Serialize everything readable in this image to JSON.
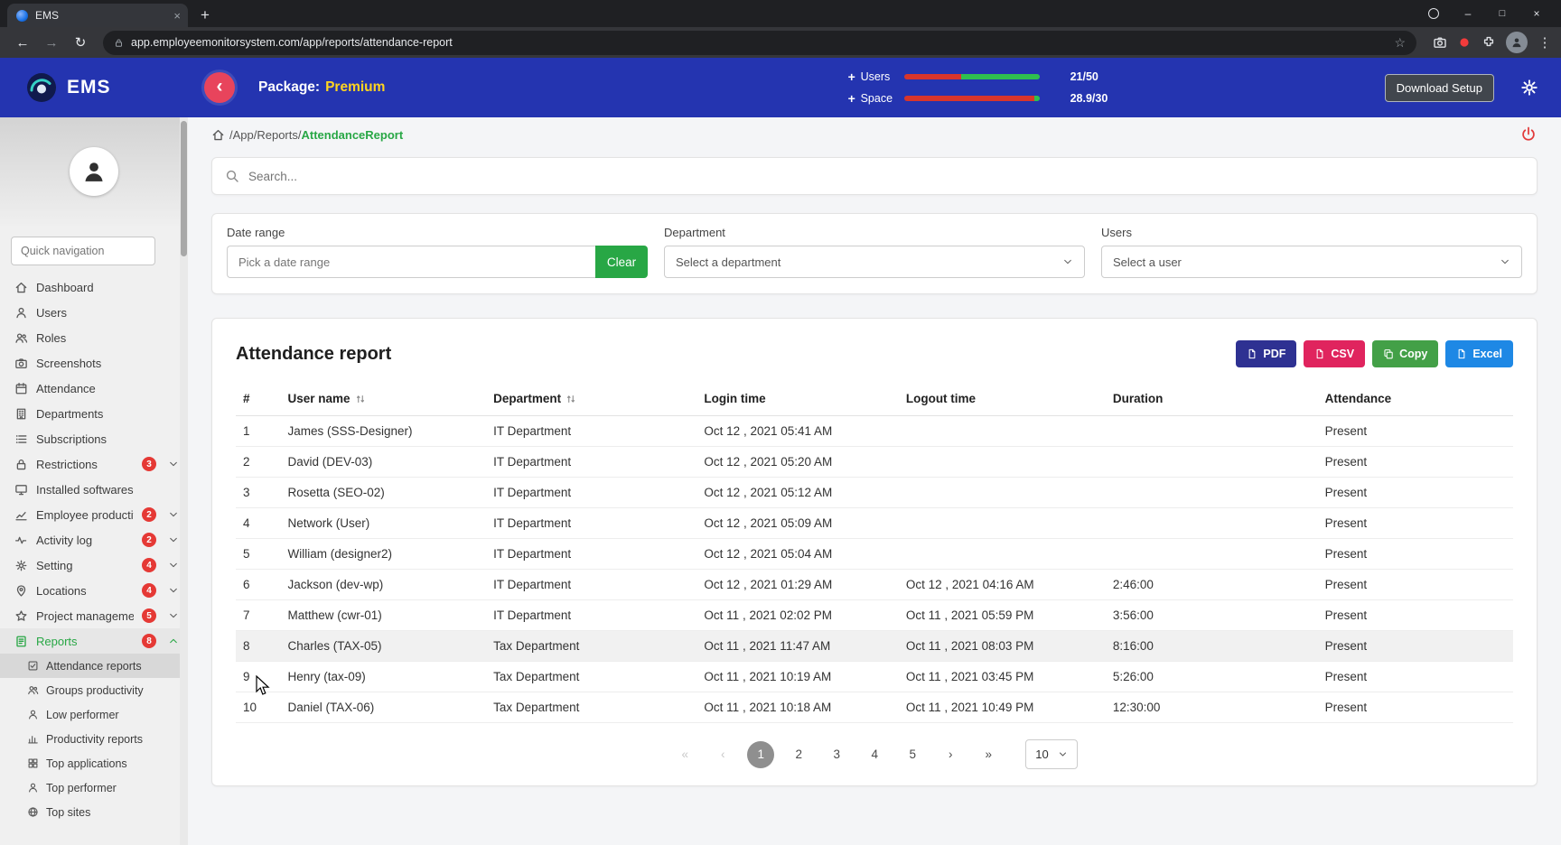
{
  "browser": {
    "tab_title": "EMS",
    "url": "app.employeemonitorsystem.com/app/reports/attendance-report",
    "glyphs": {
      "tab_close": "×",
      "new_tab": "+",
      "minimize": "–",
      "maximize": "□",
      "close": "×",
      "back": "←",
      "forward": "→",
      "reload": "↻",
      "star": "☆",
      "kebab": "⋮"
    }
  },
  "header": {
    "back_glyph": "‹",
    "package_label": "Package:",
    "package_value": "Premium",
    "add_glyph": "+",
    "users": {
      "label": "Users",
      "value": "21/50",
      "pct_used": 42
    },
    "space": {
      "label": "Space",
      "value": "28.9/30",
      "pct_used": 96
    },
    "bar_used_color": "#d8352b",
    "bar_free_color": "#2fbf4f",
    "download_button": "Download Setup"
  },
  "sidebar": {
    "quick_nav_placeholder": "Quick navigation",
    "items": [
      {
        "label": "Dashboard",
        "icon": "home-icon"
      },
      {
        "label": "Users",
        "icon": "user-icon"
      },
      {
        "label": "Roles",
        "icon": "users-icon"
      },
      {
        "label": "Screenshots",
        "icon": "camera-icon"
      },
      {
        "label": "Attendance",
        "icon": "calendar-icon"
      },
      {
        "label": "Departments",
        "icon": "building-icon"
      },
      {
        "label": "Subscriptions",
        "icon": "list-icon"
      },
      {
        "label": "Restrictions",
        "icon": "lock-icon",
        "badge": "3",
        "chevron": true
      },
      {
        "label": "Installed softwares",
        "icon": "monitor-icon"
      },
      {
        "label": "Employee productivity",
        "icon": "chart-line-icon",
        "badge": "2",
        "chevron": true
      },
      {
        "label": "Activity log",
        "icon": "activity-icon",
        "badge": "2",
        "chevron": true
      },
      {
        "label": "Setting",
        "icon": "gear-icon",
        "badge": "4",
        "chevron": true
      },
      {
        "label": "Locations",
        "icon": "pin-icon",
        "badge": "4",
        "chevron": true
      },
      {
        "label": "Project management",
        "icon": "star-icon",
        "badge": "5",
        "chevron": true
      },
      {
        "label": "Reports",
        "icon": "report-icon",
        "badge": "8",
        "chevron": true,
        "expanded": true,
        "active": true,
        "submenu": [
          {
            "label": "Attendance reports",
            "icon": "check-square-icon",
            "active": true
          },
          {
            "label": "Groups productivity",
            "icon": "users-icon"
          },
          {
            "label": "Low performer",
            "icon": "user-icon"
          },
          {
            "label": "Productivity reports",
            "icon": "bar-chart-icon"
          },
          {
            "label": "Top applications",
            "icon": "grid-icon"
          },
          {
            "label": "Top performer",
            "icon": "user-icon"
          },
          {
            "label": "Top sites",
            "icon": "globe-icon"
          }
        ]
      }
    ]
  },
  "breadcrumb": {
    "path": "/App/Reports/",
    "current": "AttendanceReport"
  },
  "search": {
    "placeholder": "Search..."
  },
  "filters": {
    "date_range_label": "Date range",
    "date_range_placeholder": "Pick a date range",
    "clear_button": "Clear",
    "department_label": "Department",
    "department_value": "Select a department",
    "users_label": "Users",
    "users_value": "Select a user"
  },
  "report": {
    "title": "Attendance report",
    "export_buttons": [
      {
        "label": "PDF",
        "color": "#2e3192",
        "icon": "file-icon"
      },
      {
        "label": "CSV",
        "color": "#e0245e",
        "icon": "file-icon"
      },
      {
        "label": "Copy",
        "color": "#43a047",
        "icon": "copy-icon"
      },
      {
        "label": "Excel",
        "color": "#1e88e5",
        "icon": "file-icon"
      }
    ],
    "table": {
      "columns": [
        {
          "label": "#",
          "sortable": false
        },
        {
          "label": "User name",
          "sortable": true
        },
        {
          "label": "Department",
          "sortable": true
        },
        {
          "label": "Login time",
          "sortable": false
        },
        {
          "label": "Logout time",
          "sortable": false
        },
        {
          "label": "Duration",
          "sortable": false
        },
        {
          "label": "Attendance",
          "sortable": false
        }
      ],
      "hover_row_index": 7,
      "rows": [
        [
          "1",
          "James (SSS-Designer)",
          "IT Department",
          "Oct 12 , 2021 05:41 AM",
          "",
          "",
          "Present"
        ],
        [
          "2",
          "David (DEV-03)",
          "IT Department",
          "Oct 12 , 2021 05:20 AM",
          "",
          "",
          "Present"
        ],
        [
          "3",
          "Rosetta (SEO-02)",
          "IT Department",
          "Oct 12 , 2021 05:12 AM",
          "",
          "",
          "Present"
        ],
        [
          "4",
          "Network (User)",
          "IT Department",
          "Oct 12 , 2021 05:09 AM",
          "",
          "",
          "Present"
        ],
        [
          "5",
          "William (designer2)",
          "IT Department",
          "Oct 12 , 2021 05:04 AM",
          "",
          "",
          "Present"
        ],
        [
          "6",
          "Jackson (dev-wp)",
          "IT Department",
          "Oct 12 , 2021 01:29 AM",
          "Oct 12 , 2021 04:16 AM",
          "2:46:00",
          "Present"
        ],
        [
          "7",
          "Matthew (cwr-01)",
          "IT Department",
          "Oct 11 , 2021 02:02 PM",
          "Oct 11 , 2021 05:59 PM",
          "3:56:00",
          "Present"
        ],
        [
          "8",
          "Charles (TAX-05)",
          "Tax Department",
          "Oct 11 , 2021 11:47 AM",
          "Oct 11 , 2021 08:03 PM",
          "8:16:00",
          "Present"
        ],
        [
          "9",
          "Henry (tax-09)",
          "Tax Department",
          "Oct 11 , 2021 10:19 AM",
          "Oct 11 , 2021 03:45 PM",
          "5:26:00",
          "Present"
        ],
        [
          "10",
          "Daniel (TAX-06)",
          "Tax Department",
          "Oct 11 , 2021 10:18 AM",
          "Oct 11 , 2021 10:49 PM",
          "12:30:00",
          "Present"
        ]
      ]
    },
    "pagination": {
      "first_glyph": "«",
      "prev_glyph": "‹",
      "next_glyph": "›",
      "last_glyph": "»",
      "pages": [
        "1",
        "2",
        "3",
        "4",
        "5"
      ],
      "current": "1",
      "page_size": "10"
    }
  }
}
